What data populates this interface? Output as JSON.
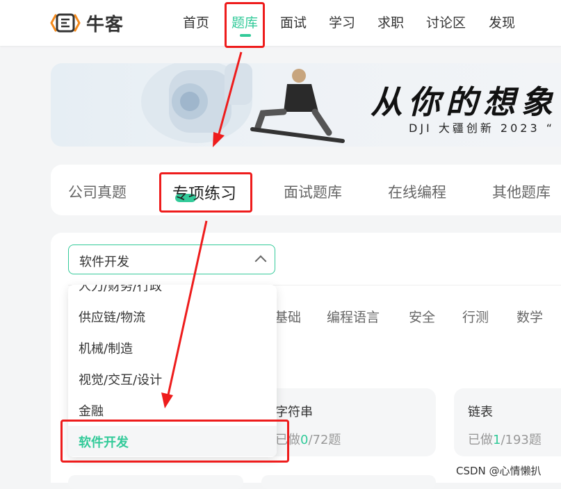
{
  "header": {
    "logo_text": "牛客",
    "nav": [
      "首页",
      "题库",
      "面试",
      "学习",
      "求职",
      "讨论区",
      "发现"
    ],
    "active_nav": "题库"
  },
  "banner": {
    "title": "从你的想象",
    "subtitle": "DJI 大疆创新 2023 “"
  },
  "tabs": [
    "公司真题",
    "专项练习",
    "面试题库",
    "在线编程",
    "其他题库"
  ],
  "active_tab": "专项练习",
  "select": {
    "value": "软件开发"
  },
  "categories": [
    "基础",
    "编程语言",
    "安全",
    "行测",
    "数学"
  ],
  "dropdown": {
    "partial_item": "人力/财务/行政",
    "items": [
      "供应链/物流",
      "机械/制造",
      "视觉/交互/设计",
      "金融"
    ],
    "selected": "软件开发"
  },
  "tiles": [
    {
      "title": "字符串",
      "progress_label": "已做",
      "done": "0",
      "total": "/72题"
    },
    {
      "title": "链表",
      "progress_label": "已做",
      "done": "1",
      "total": "/193题"
    }
  ],
  "watermark": "CSDN @心情懒扒",
  "colors": {
    "accent": "#32ca99",
    "annotation": "#ee1c1c"
  }
}
